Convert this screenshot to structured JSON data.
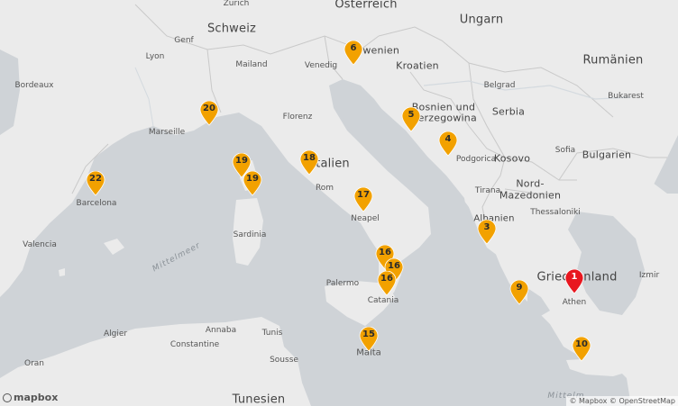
{
  "labels": {
    "countries": [
      "Österreich",
      "Schweiz",
      "Ungarn",
      "Slowenien",
      "Kroatien",
      "Rumänien",
      "Bosnien und",
      "Herzegowina",
      "Serbia",
      "Italien",
      "Kosovo",
      "Nord-",
      "Mazedonien",
      "Bulgarien",
      "Albanien",
      "Griechenland",
      "Tunesien"
    ],
    "cities": [
      "Zürich",
      "Genf",
      "Lyon",
      "Mailand",
      "Venedig",
      "Bordeaux",
      "Marseille",
      "Florenz",
      "Rom",
      "Neapel",
      "Barcelona",
      "Valencia",
      "Sardinia",
      "Palermo",
      "Catania",
      "Malta",
      "Algier",
      "Constantine",
      "Annaba",
      "Tunis",
      "Sousse",
      "Oran",
      "Belgrad",
      "Bukarest",
      "Sofia",
      "Podgorica",
      "Tirana",
      "Thessaloniki",
      "Athen",
      "Izmir"
    ],
    "seas": [
      "Mittelmeer",
      "Mittelm"
    ]
  },
  "markers": [
    {
      "label": "1",
      "color": "#e8171f"
    },
    {
      "label": "3",
      "color": "#f2a100"
    },
    {
      "label": "4",
      "color": "#f2a100"
    },
    {
      "label": "5",
      "color": "#f2a100"
    },
    {
      "label": "6",
      "color": "#f2a100"
    },
    {
      "label": "9",
      "color": "#f2a100"
    },
    {
      "label": "10",
      "color": "#f2a100"
    },
    {
      "label": "15",
      "color": "#f2a100"
    },
    {
      "label": "16",
      "color": "#f2a100"
    },
    {
      "label": "16",
      "color": "#f2a100"
    },
    {
      "label": "16",
      "color": "#f2a100"
    },
    {
      "label": "17",
      "color": "#f2a100"
    },
    {
      "label": "18",
      "color": "#f2a100"
    },
    {
      "label": "19",
      "color": "#f2a100"
    },
    {
      "label": "19",
      "color": "#f2a100"
    },
    {
      "label": "20",
      "color": "#f2a100"
    },
    {
      "label": "22",
      "color": "#f2a100"
    }
  ],
  "logo": "mapbox",
  "attribution": "© Mapbox © OpenStreetMap"
}
